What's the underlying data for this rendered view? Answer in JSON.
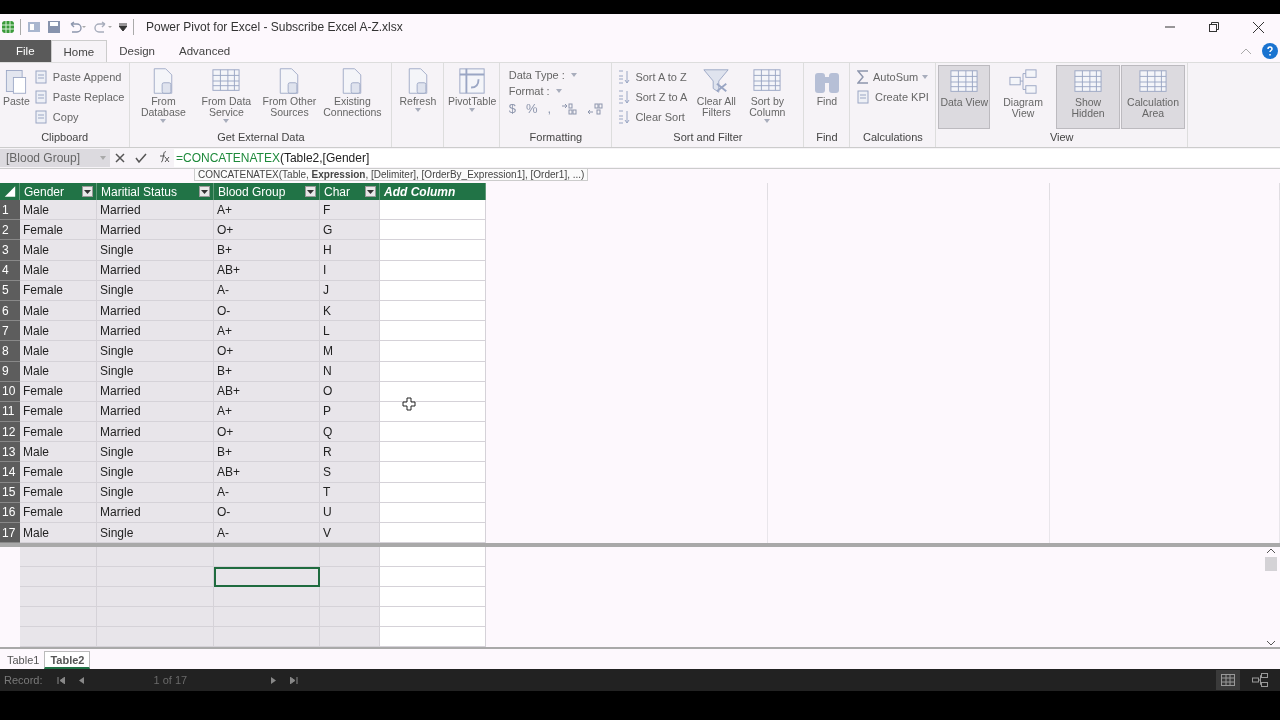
{
  "window": {
    "title": "Power Pivot for Excel - Subscribe Excel A-Z.xlsx"
  },
  "menu_tabs": [
    {
      "label": "File",
      "kind": "file",
      "selected": false
    },
    {
      "label": "Home",
      "kind": "tab",
      "selected": true
    },
    {
      "label": "Design",
      "kind": "tab",
      "selected": false
    },
    {
      "label": "Advanced",
      "kind": "tab",
      "selected": false
    }
  ],
  "ribbon": [
    {
      "label": "Clipboard",
      "items": [
        {
          "kind": "large",
          "label": "Paste",
          "dropdown": false
        },
        {
          "kind": "stack",
          "entries": [
            {
              "label": "Paste Append",
              "dropdown": false
            },
            {
              "label": "Paste Replace",
              "dropdown": false
            },
            {
              "label": "Copy",
              "dropdown": false
            }
          ]
        }
      ]
    },
    {
      "label": "Get External Data",
      "items": [
        {
          "kind": "large",
          "label": "From Database",
          "dropdown": true
        },
        {
          "kind": "large",
          "label": "From Data Service",
          "dropdown": true
        },
        {
          "kind": "large",
          "label": "From Other Sources",
          "dropdown": false
        },
        {
          "kind": "large",
          "label": "Existing Connections",
          "dropdown": false
        }
      ]
    },
    {
      "items": [
        {
          "kind": "large",
          "label": "Refresh",
          "dropdown": true
        }
      ]
    },
    {
      "items": [
        {
          "kind": "large",
          "label": "PivotTable",
          "dropdown": true
        }
      ]
    },
    {
      "label": "Formatting",
      "items": [
        {
          "kind": "format",
          "combos": [
            "Data Type :",
            "Format :"
          ],
          "symbols": [
            "$",
            "%",
            ","
          ]
        }
      ]
    },
    {
      "label": "Sort and Filter",
      "items": [
        {
          "kind": "stack",
          "entries": [
            {
              "label": "Sort A to Z",
              "dropdown": false
            },
            {
              "label": "Sort Z to A",
              "dropdown": false
            },
            {
              "label": "Clear Sort",
              "dropdown": false
            }
          ]
        },
        {
          "kind": "large",
          "label": "Clear All Filters",
          "dropdown": false
        },
        {
          "kind": "large",
          "label": "Sort by Column",
          "dropdown": true
        }
      ]
    },
    {
      "label": "Find",
      "items": [
        {
          "kind": "large",
          "label": "Find",
          "dropdown": false
        }
      ]
    },
    {
      "label": "Calculations",
      "items": [
        {
          "kind": "stack",
          "entries": [
            {
              "label": "AutoSum",
              "dropdown": true
            },
            {
              "label": "Create KPI",
              "dropdown": false
            }
          ]
        }
      ]
    },
    {
      "label": "View",
      "items": [
        {
          "kind": "toggle",
          "label": "Data View",
          "pressed": true
        },
        {
          "kind": "toggle",
          "label": "Diagram View",
          "pressed": false
        },
        {
          "kind": "toggle",
          "label": "Show Hidden",
          "pressed": true
        },
        {
          "kind": "toggle",
          "label": "Calculation Area",
          "pressed": true
        }
      ]
    }
  ],
  "formula_bar": {
    "name_box": "[Blood Group]",
    "formula_function": "=CONCATENATEX",
    "formula_rest": "(Table2,[Gender]",
    "tooltip": "CONCATENATEX(Table, **Expression**, [Delimiter], [OrderBy_Expression1], [Order1], ...)"
  },
  "table": {
    "columns": [
      {
        "label": "Gender",
        "kind": "data"
      },
      {
        "label": "Maritial Status",
        "kind": "data"
      },
      {
        "label": "Blood Group",
        "kind": "data"
      },
      {
        "label": "Char",
        "kind": "data"
      },
      {
        "label": "Add Column",
        "kind": "add"
      }
    ],
    "rows": [
      {
        "n": "1",
        "cells": [
          "Male",
          "Married",
          "A+",
          "F"
        ]
      },
      {
        "n": "2",
        "cells": [
          "Female",
          "Married",
          "O+",
          "G"
        ]
      },
      {
        "n": "3",
        "cells": [
          "Male",
          "Single",
          "B+",
          "H"
        ]
      },
      {
        "n": "4",
        "cells": [
          "Male",
          "Married",
          "AB+",
          "I"
        ]
      },
      {
        "n": "5",
        "cells": [
          "Female",
          "Single",
          "A-",
          "J"
        ]
      },
      {
        "n": "6",
        "cells": [
          "Male",
          "Married",
          "O-",
          "K"
        ]
      },
      {
        "n": "7",
        "cells": [
          "Male",
          "Married",
          "A+",
          "L"
        ]
      },
      {
        "n": "8",
        "cells": [
          "Male",
          "Single",
          "O+",
          "M"
        ]
      },
      {
        "n": "9",
        "cells": [
          "Male",
          "Single",
          "B+",
          "N"
        ]
      },
      {
        "n": "10",
        "cells": [
          "Female",
          "Married",
          "AB+",
          "O"
        ]
      },
      {
        "n": "11",
        "cells": [
          "Female",
          "Married",
          "A+",
          "P"
        ]
      },
      {
        "n": "12",
        "cells": [
          "Female",
          "Married",
          "O+",
          "Q"
        ]
      },
      {
        "n": "13",
        "cells": [
          "Male",
          "Single",
          "B+",
          "R"
        ]
      },
      {
        "n": "14",
        "cells": [
          "Female",
          "Single",
          "AB+",
          "S"
        ]
      },
      {
        "n": "15",
        "cells": [
          "Female",
          "Single",
          "A-",
          "T"
        ]
      },
      {
        "n": "16",
        "cells": [
          "Female",
          "Married",
          "O-",
          "U"
        ]
      },
      {
        "n": "17",
        "cells": [
          "Male",
          "Single",
          "A-",
          "V"
        ]
      }
    ]
  },
  "sheet_tabs": [
    {
      "label": "Table1",
      "selected": false
    },
    {
      "label": "Table2",
      "selected": true
    }
  ],
  "status_bar": {
    "label": "Record:",
    "position": "1 of 17",
    "views": [
      {
        "kind": "grid",
        "selected": true
      },
      {
        "kind": "diagram",
        "selected": false
      }
    ]
  }
}
